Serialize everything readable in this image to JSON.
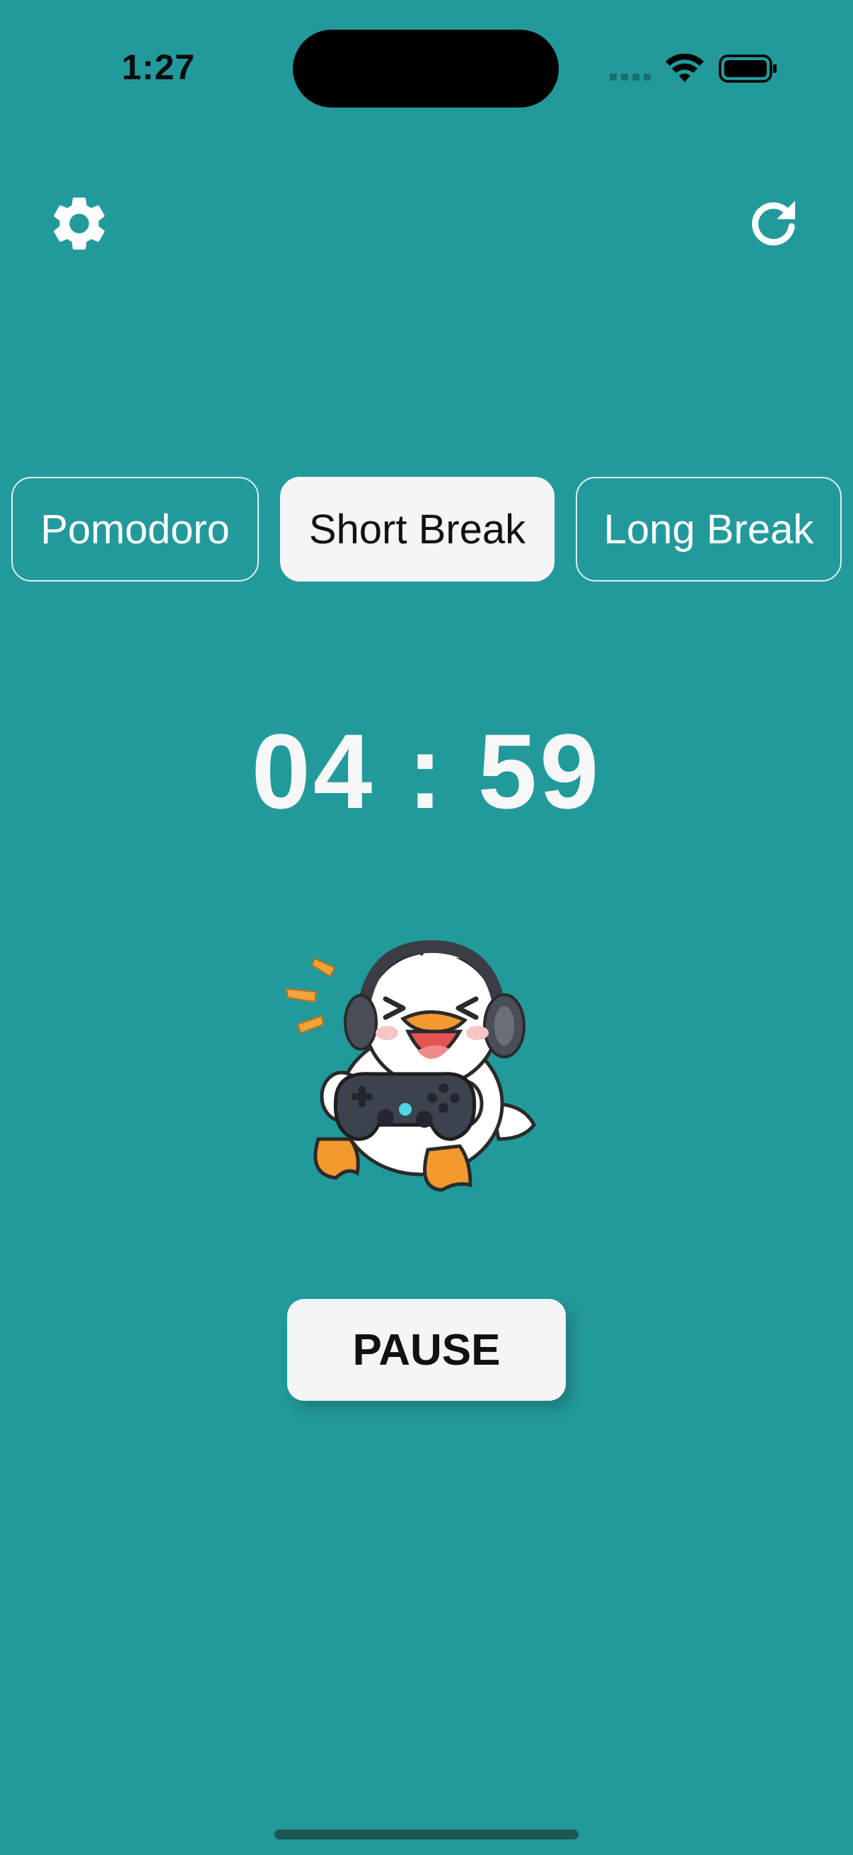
{
  "status_bar": {
    "time": "1:27"
  },
  "toolbar": {
    "settings_icon": "gear-icon",
    "reset_icon": "refresh-icon"
  },
  "tabs": [
    {
      "label": "Pomodoro",
      "active": false
    },
    {
      "label": "Short Break",
      "active": true
    },
    {
      "label": "Long Break",
      "active": false
    }
  ],
  "timer": {
    "display": "04 : 59"
  },
  "mascot": {
    "icon": "duck-gamer-mascot-icon"
  },
  "controls": {
    "pause_label": "PAUSE"
  },
  "colors": {
    "background": "#229a9c",
    "button_fill": "#f5f5f5",
    "text_light": "#f7f7f7",
    "text_dark": "#111111"
  }
}
